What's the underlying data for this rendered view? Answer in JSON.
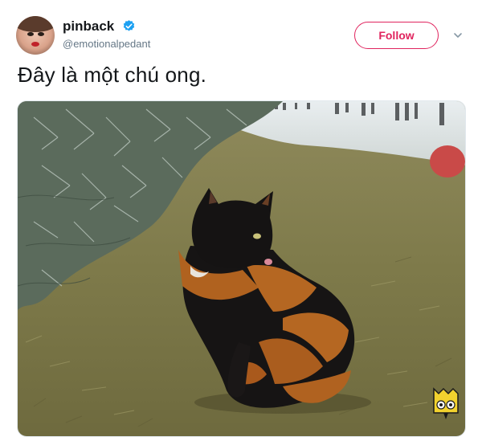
{
  "user": {
    "display_name": "pinback",
    "handle": "@emotionalpedant",
    "verified": true,
    "verified_color": "#1da1f2"
  },
  "actions": {
    "follow_label": "Follow",
    "follow_color": "#e0245e",
    "more_icon": "chevron-down-icon"
  },
  "tweet": {
    "text": "Đây là một chú ong."
  },
  "media": {
    "type": "photo",
    "watermark_icon": "brand-logo-icon"
  }
}
